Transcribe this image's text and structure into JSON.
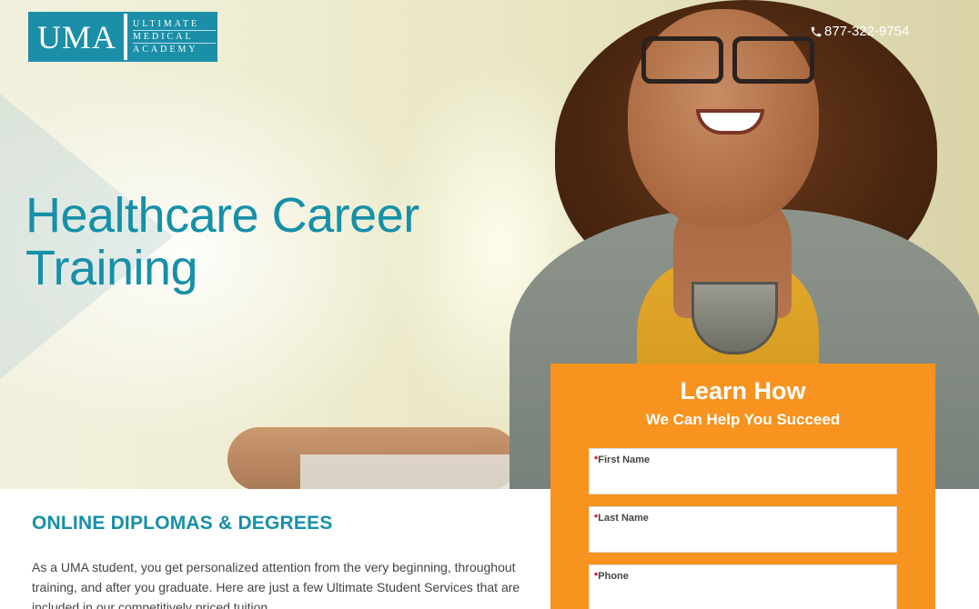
{
  "brand": {
    "logo_abbr": "UMA",
    "logo_lines": [
      "ULTIMATE",
      "MEDICAL",
      "ACADEMY"
    ],
    "accent_color": "#1590a8",
    "cta_color": "#f7931e"
  },
  "header": {
    "phone_icon": "phone-icon",
    "phone": "877-322-9754"
  },
  "hero": {
    "headline_line1": "Healthcare Career",
    "headline_line2": "Training"
  },
  "form": {
    "title": "Learn How",
    "subtitle": "We Can Help You Succeed",
    "required_mark": "*",
    "fields": [
      {
        "label": "First Name",
        "value": ""
      },
      {
        "label": "Last Name",
        "value": ""
      },
      {
        "label": "Phone",
        "value": ""
      }
    ]
  },
  "content": {
    "title": "ONLINE DIPLOMAS & DEGREES",
    "body": "As a UMA student, you get personalized attention from the very beginning, throughout training, and after you graduate. Here are just a few Ultimate Student Services that are included in our competitively priced tuition."
  }
}
